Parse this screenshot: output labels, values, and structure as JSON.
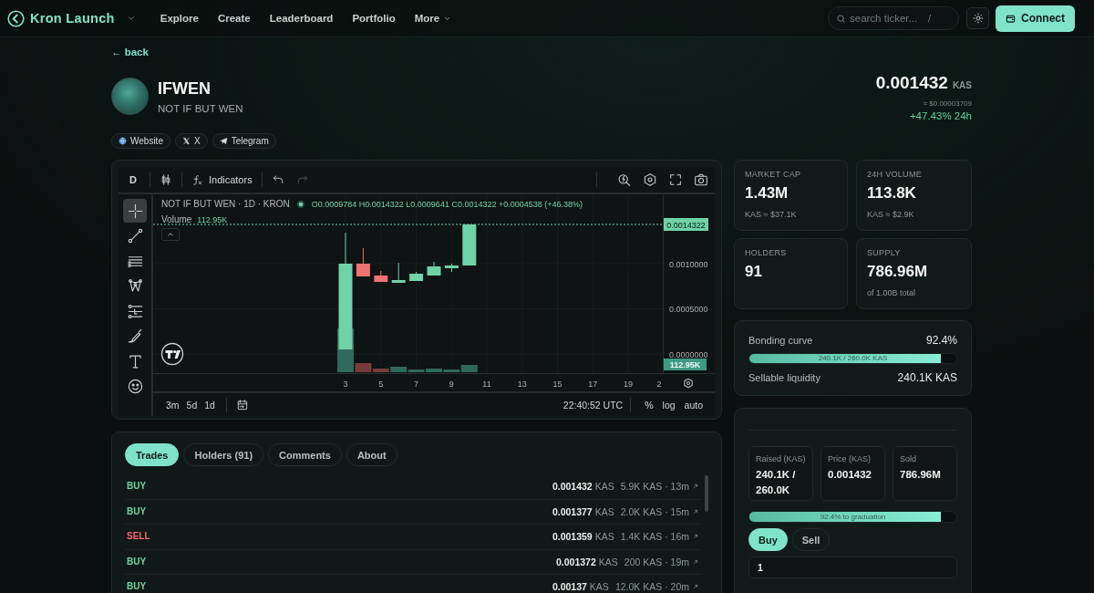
{
  "nav": {
    "logo": "Kron Launch",
    "links": [
      {
        "label": "Explore",
        "dropdown": false
      },
      {
        "label": "Create",
        "dropdown": false
      },
      {
        "label": "Leaderboard",
        "dropdown": false
      },
      {
        "label": "Portfolio",
        "dropdown": false
      },
      {
        "label": "More",
        "dropdown": true
      }
    ],
    "search": {
      "placeholder": "search ticker...",
      "shortcut": "/"
    },
    "connect_button": "Connect"
  },
  "back_link": "← back",
  "token": {
    "symbol": "IFWEN",
    "name": "NOT IF BUT WEN",
    "price": "0.001432",
    "price_unit": "KAS",
    "price_usd": "≈ $0.00003709",
    "change": "+47.43% 24h",
    "links": [
      {
        "kind": "globe",
        "label": "Website"
      },
      {
        "kind": "x",
        "label": "X"
      },
      {
        "kind": "plane",
        "label": "Telegram"
      }
    ]
  },
  "chart": {
    "interval": "D",
    "indicators_button": "Indicators",
    "redo_disabled": true,
    "tools": [
      {
        "kind": "crosshair",
        "selected": true
      },
      {
        "kind": "trend_line",
        "selected": false
      },
      {
        "kind": "horizontal_lines",
        "selected": false
      },
      {
        "kind": "pattern",
        "selected": false
      },
      {
        "kind": "position",
        "selected": false
      },
      {
        "kind": "brush",
        "selected": false
      },
      {
        "kind": "text",
        "selected": false
      },
      {
        "kind": "emoji",
        "selected": false
      }
    ],
    "legend": {
      "title": "NOT IF BUT WEN · 1D · KRON",
      "ohlc": "O0.0009784 H0.0014322 L0.0009641 C0.0014322 +0.0004538 (+46.38%)",
      "volume_label": "Volume",
      "volume_value": "112.95K"
    },
    "last_price": "0.0014322",
    "price_axis": [
      "0.0010000",
      "0.0005000",
      "0.0000000"
    ],
    "volume_axis": "112.95K",
    "time_axis": [
      "3",
      "5",
      "7",
      "9",
      "11",
      "13",
      "15",
      "17",
      "19",
      "2"
    ],
    "ranges": [
      "3m",
      "5d",
      "1d"
    ],
    "clock": "22:40:52 UTC",
    "scale_options": [
      "%",
      "log",
      "auto"
    ]
  },
  "stats": [
    {
      "label": "MARKET CAP",
      "value": "1.43M",
      "sub": "KAS ≈ $37.1K"
    },
    {
      "label": "24H VOLUME",
      "value": "113.8K",
      "sub": "KAS ≈ $2.9K"
    },
    {
      "label": "HOLDERS",
      "value": "91"
    },
    {
      "label": "SUPPLY",
      "value": "786.96M",
      "sub": "of 1.00B total"
    }
  ],
  "bonding": {
    "label": "Bonding curve",
    "percent": "92.4%",
    "level": 0.924,
    "bar_text": "240.1K / 260.0K KAS",
    "liquidity_label": "Sellable liquidity",
    "liquidity_value": "240.1K KAS"
  },
  "activity": {
    "tabs": [
      {
        "label": "Trades",
        "selected": true
      },
      {
        "label": "Holders (91)",
        "selected": false
      },
      {
        "label": "Comments",
        "selected": false
      },
      {
        "label": "About",
        "selected": false
      }
    ],
    "trades": [
      {
        "kind": "buy",
        "label": "BUY",
        "price": "0.001432",
        "unit": "KAS",
        "amount": "5.9K KAS · 13m"
      },
      {
        "kind": "buy",
        "label": "BUY",
        "price": "0.001377",
        "unit": "KAS",
        "amount": "2.0K KAS · 15m"
      },
      {
        "kind": "sell",
        "label": "SELL",
        "price": "0.001359",
        "unit": "KAS",
        "amount": "1.4K KAS · 16m"
      },
      {
        "kind": "buy",
        "label": "BUY",
        "price": "0.001372",
        "unit": "KAS",
        "amount": "200 KAS · 19m"
      },
      {
        "kind": "buy",
        "label": "BUY",
        "price": "0.00137",
        "unit": "KAS",
        "amount": "12.0K KAS · 20m"
      }
    ]
  },
  "trade_panel": {
    "metrics": [
      {
        "label": "Raised (KAS)",
        "value": "240.1K / 260.0K"
      },
      {
        "label": "Price (KAS)",
        "value": "0.001432"
      },
      {
        "label": "Sold",
        "value": "786.96M"
      }
    ],
    "progress": {
      "level": 0.924,
      "text": "92.4% to graduation"
    },
    "modes": [
      {
        "label": "Buy",
        "selected": true
      },
      {
        "label": "Sell",
        "selected": false
      }
    ],
    "amount": {
      "value": "1"
    }
  }
}
